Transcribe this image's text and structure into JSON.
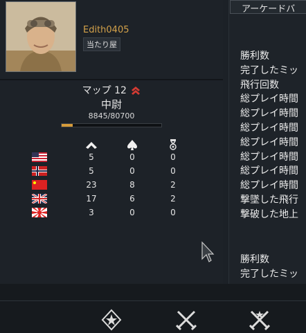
{
  "profile": {
    "username": "Edith0405",
    "title": "当たり屋"
  },
  "rank": {
    "map_label": "マップ 12",
    "rank_name": "中尉",
    "exp_text": "8845/80700",
    "exp_progress": 0.11
  },
  "stats_table": {
    "columns": [
      "chevron-up-icon",
      "spade-icon",
      "medal-icon"
    ],
    "rows": [
      {
        "nation": "usa-flag-icon",
        "values": [
          "5",
          "0",
          "0"
        ]
      },
      {
        "nation": "norway-flag-icon",
        "values": [
          "5",
          "0",
          "0"
        ]
      },
      {
        "nation": "china-flag-icon",
        "values": [
          "23",
          "8",
          "2"
        ]
      },
      {
        "nation": "uk-flag-icon",
        "values": [
          "17",
          "6",
          "2"
        ]
      },
      {
        "nation": "japan-flag-icon",
        "values": [
          "3",
          "0",
          "0"
        ]
      }
    ]
  },
  "right_panel": {
    "mode_select": "アーケードバ",
    "labels": [
      "勝利数",
      "完了したミッ",
      "飛行回数",
      "総プレイ時間",
      "総プレイ時間",
      "総プレイ時間",
      "総プレイ時間",
      "総プレイ時間",
      "総プレイ時間",
      "総プレイ時間",
      "撃墜した飛行",
      "撃破した地上"
    ],
    "labels_bottom": [
      "勝利数",
      "完了したミッ"
    ]
  },
  "bottom_bar": {
    "icons": [
      "star-shield-icon",
      "crossed-swords-icon",
      "crossed-swords-star-icon"
    ]
  },
  "colors": {
    "accent_orange": "#d69b3a",
    "username": "#d4a24a",
    "background": "#1c2127"
  }
}
